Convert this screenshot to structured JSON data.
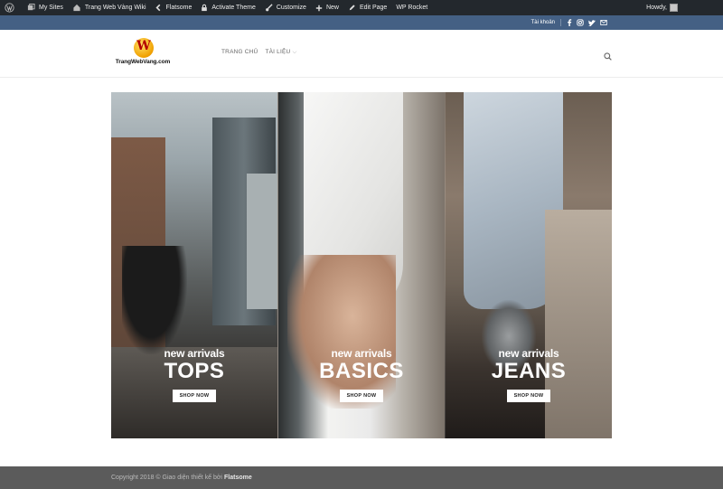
{
  "admin_bar": {
    "items": [
      {
        "label": "",
        "icon": "wordpress-icon"
      },
      {
        "label": "My Sites",
        "icon": "my-sites-icon"
      },
      {
        "label": "Trang Web Vàng Wiki",
        "icon": "home-icon"
      },
      {
        "label": "Flatsome",
        "icon": "flatsome-icon"
      },
      {
        "label": "Activate Theme",
        "icon": "lock-icon"
      },
      {
        "label": "Customize",
        "icon": "brush-icon"
      },
      {
        "label": "New",
        "icon": "plus-icon"
      },
      {
        "label": "Edit Page",
        "icon": "pencil-icon"
      },
      {
        "label": "WP Rocket",
        "icon": ""
      }
    ],
    "howdy": "Howdy,"
  },
  "top_bar": {
    "account": "Tài khoản",
    "socials": [
      "facebook-icon",
      "instagram-icon",
      "twitter-icon",
      "email-icon"
    ]
  },
  "header": {
    "logo_letter": "W",
    "logo_text": "TrangWebVang.com",
    "nav": [
      {
        "label": "TRANG CHỦ"
      },
      {
        "label": "TÀI LIỆU",
        "dropdown": "⌵"
      }
    ]
  },
  "banners": [
    {
      "small": "new arrivals",
      "big": "TOPS",
      "button": "SHOP NOW"
    },
    {
      "small": "new arrivals",
      "big": "BASICS",
      "button": "SHOP NOW"
    },
    {
      "small": "new arrivals",
      "big": "JEANS",
      "button": "SHOP NOW"
    }
  ],
  "footer": {
    "text": "Copyright 2018 © Giao diện thiết kế bởi",
    "brand": "Flatsome"
  },
  "colors": {
    "admin_bar": "#23282d",
    "top_bar": "#446084",
    "footer": "#5b5b5b"
  }
}
